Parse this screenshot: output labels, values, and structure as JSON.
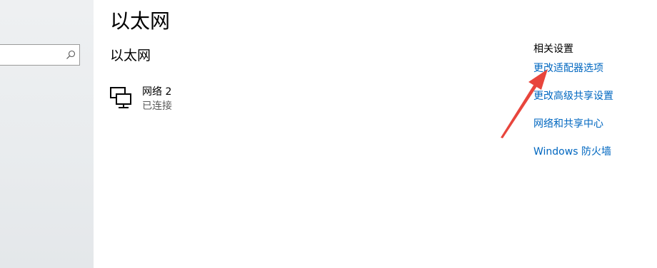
{
  "search": {
    "placeholder": ""
  },
  "page": {
    "title": "以太网"
  },
  "section": {
    "title": "以太网"
  },
  "network": {
    "name": "网络 2",
    "status": "已连接",
    "icon": "ethernet-icon"
  },
  "related": {
    "title": "相关设置",
    "links": [
      {
        "label": "更改适配器选项"
      },
      {
        "label": "更改高级共享设置"
      },
      {
        "label": "网络和共享中心"
      },
      {
        "label": "Windows 防火墙"
      }
    ]
  },
  "colors": {
    "link": "#0067c0",
    "annotation_arrow": "#e8453c",
    "sidebar_bg": "#e9ecee"
  }
}
